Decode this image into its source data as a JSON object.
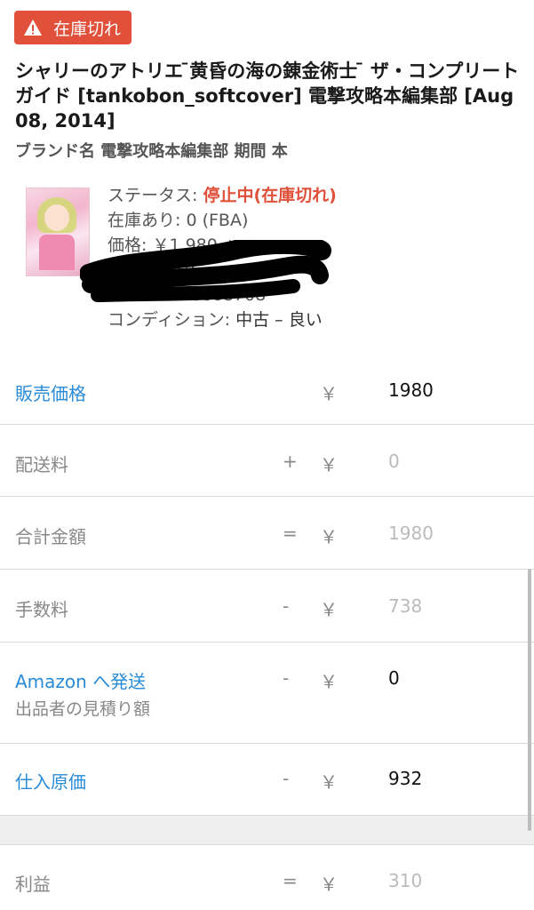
{
  "badge": {
    "icon": "warning-icon",
    "label": "在庫切れ"
  },
  "product": {
    "title": "シャリーのアトリエ ̄黄昏の海の錬金術士 ̄ ザ・コンプリートガイド [tankobon_softcover] 電撃攻略本編集部 [Aug 08, 2014]",
    "brand": "ブランド名 電撃攻略本編集部 期間 本"
  },
  "info": {
    "status_label": "ステータス: ",
    "status_value": "停止中(在庫切れ)",
    "stock": "在庫あり: 0 (FBA)",
    "price": "価格: ￥1,980 +",
    "sku": "SKU: 2019",
    "asin": "ASIN: 4048668708",
    "condition_label": "コンディション: ",
    "condition_value": "中古 – 良い"
  },
  "rows": [
    {
      "label": "販売価格",
      "op": "",
      "yen": "￥",
      "value": "1980"
    },
    {
      "label": "配送料",
      "op": "+",
      "yen": "￥",
      "value": "0"
    },
    {
      "label": "合計金額",
      "op": "=",
      "yen": "￥",
      "value": "1980"
    },
    {
      "label": "手数料",
      "op": "-",
      "yen": "￥",
      "value": "738"
    },
    {
      "label": "Amazon へ発送",
      "sub": "出品者の見積り額",
      "op": "-",
      "yen": "￥",
      "value": "0"
    },
    {
      "label": "仕入原価",
      "op": "-",
      "yen": "￥",
      "value": "932"
    },
    {
      "label": "利益",
      "op": "=",
      "yen": "￥",
      "value": "310"
    }
  ],
  "colors": {
    "accent": "#2a8bd6",
    "alert": "#e0503a",
    "muted": "#888888"
  }
}
